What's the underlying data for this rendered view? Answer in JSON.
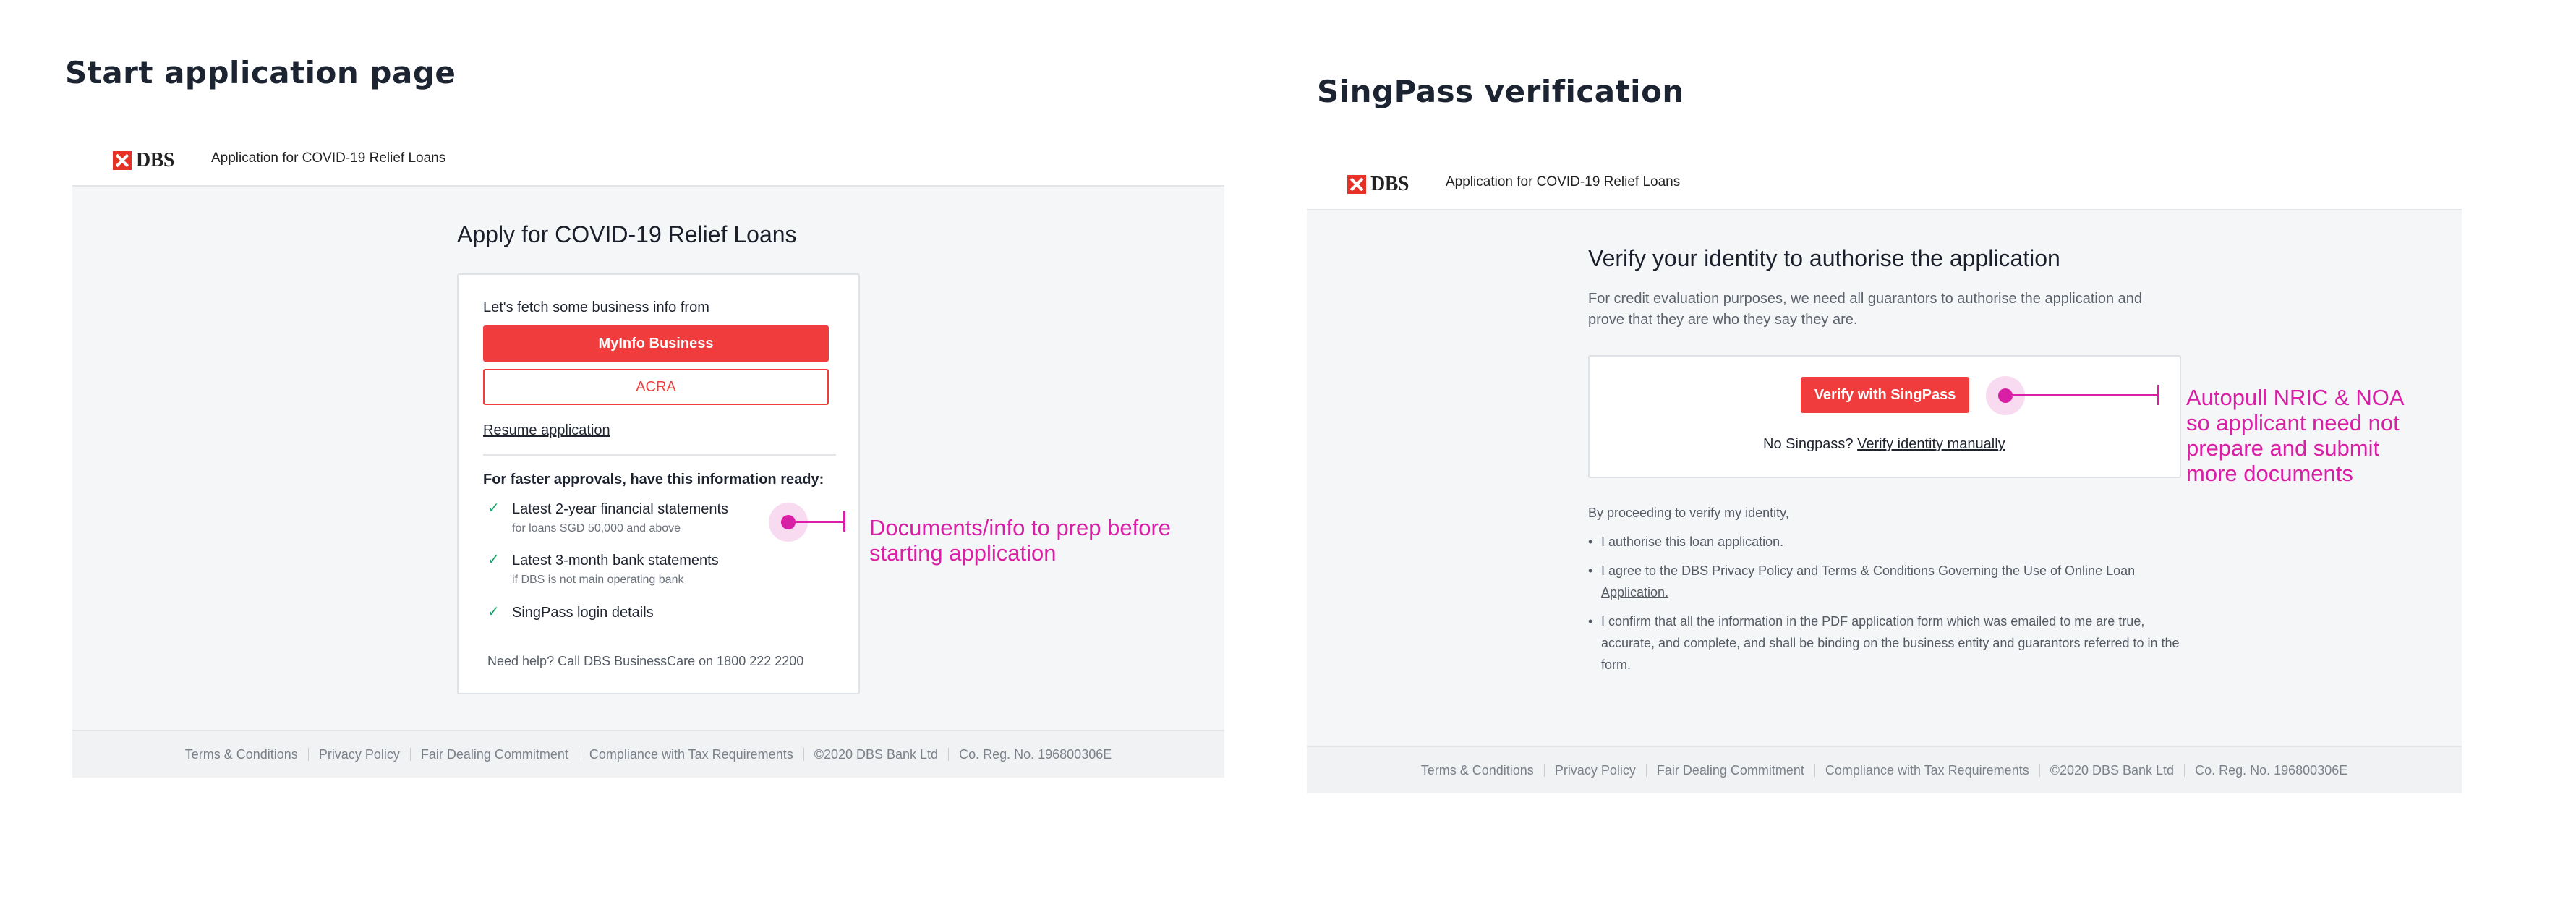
{
  "left": {
    "section_title": "Start application page",
    "header": {
      "logo_text": "DBS",
      "title": "Application for COVID-19 Relief Loans"
    },
    "heading": "Apply for COVID-19 Relief Loans",
    "card": {
      "fetch_label": "Let's fetch some business info from",
      "myinfo_button": "MyInfo Business",
      "acra_button": "ACRA",
      "resume_link": "Resume application",
      "faster_title": "For faster approvals, have this information ready:",
      "items": [
        {
          "main": "Latest 2-year financial statements",
          "sub": "for loans SGD 50,000 and above"
        },
        {
          "main": "Latest 3-month bank statements",
          "sub": "if DBS is not main operating bank"
        },
        {
          "main": "SingPass login details",
          "sub": ""
        }
      ],
      "help_text": "Need help? Call DBS BusinessCare on 1800 222 2200"
    },
    "annotation": [
      "Documents/info to prep before",
      "starting application"
    ],
    "footer": [
      "Terms & Conditions",
      "Privacy Policy",
      "Fair Dealing Commitment",
      "Compliance with Tax Requirements",
      "©2020 DBS Bank Ltd",
      "Co. Reg. No. 196800306E"
    ]
  },
  "right": {
    "section_title": "SingPass verification",
    "header": {
      "logo_text": "DBS",
      "title": "Application for COVID-19 Relief Loans"
    },
    "heading": "Verify your identity to authorise the application",
    "description": [
      "For credit evaluation purposes, we need all guarantors to authorise the application and",
      "prove that they are who they say they are."
    ],
    "verify_button": "Verify with SingPass",
    "no_singpass": "No Singpass?",
    "manual_link": "Verify identity manually",
    "proceed_text": "By proceeding to verify my identity,",
    "bullets": {
      "b1": "I authorise this loan application.",
      "b2_prefix": "I agree to the",
      "b2_link1": "DBS Privacy Policy",
      "b2_and": "and",
      "b2_link2": "Terms & Conditions Governing the Use of Online Loan Application.",
      "b3": "I confirm that all the information in the PDF application form which was emailed to me are true, accurate, and complete, and shall be binding on the business entity and guarantors referred to in the form."
    },
    "annotation": [
      "Autopull NRIC & NOA",
      "so applicant need not",
      "prepare and submit",
      "more documents"
    ],
    "footer": [
      "Terms & Conditions",
      "Privacy Policy",
      "Fair Dealing Commitment",
      "Compliance with Tax Requirements",
      "©2020 DBS Bank Ltd",
      "Co. Reg. No. 196800306E"
    ]
  },
  "colors": {
    "brand_red": "#f03c3c",
    "annotation": "#d81fa6",
    "check_green": "#1aa36b"
  }
}
